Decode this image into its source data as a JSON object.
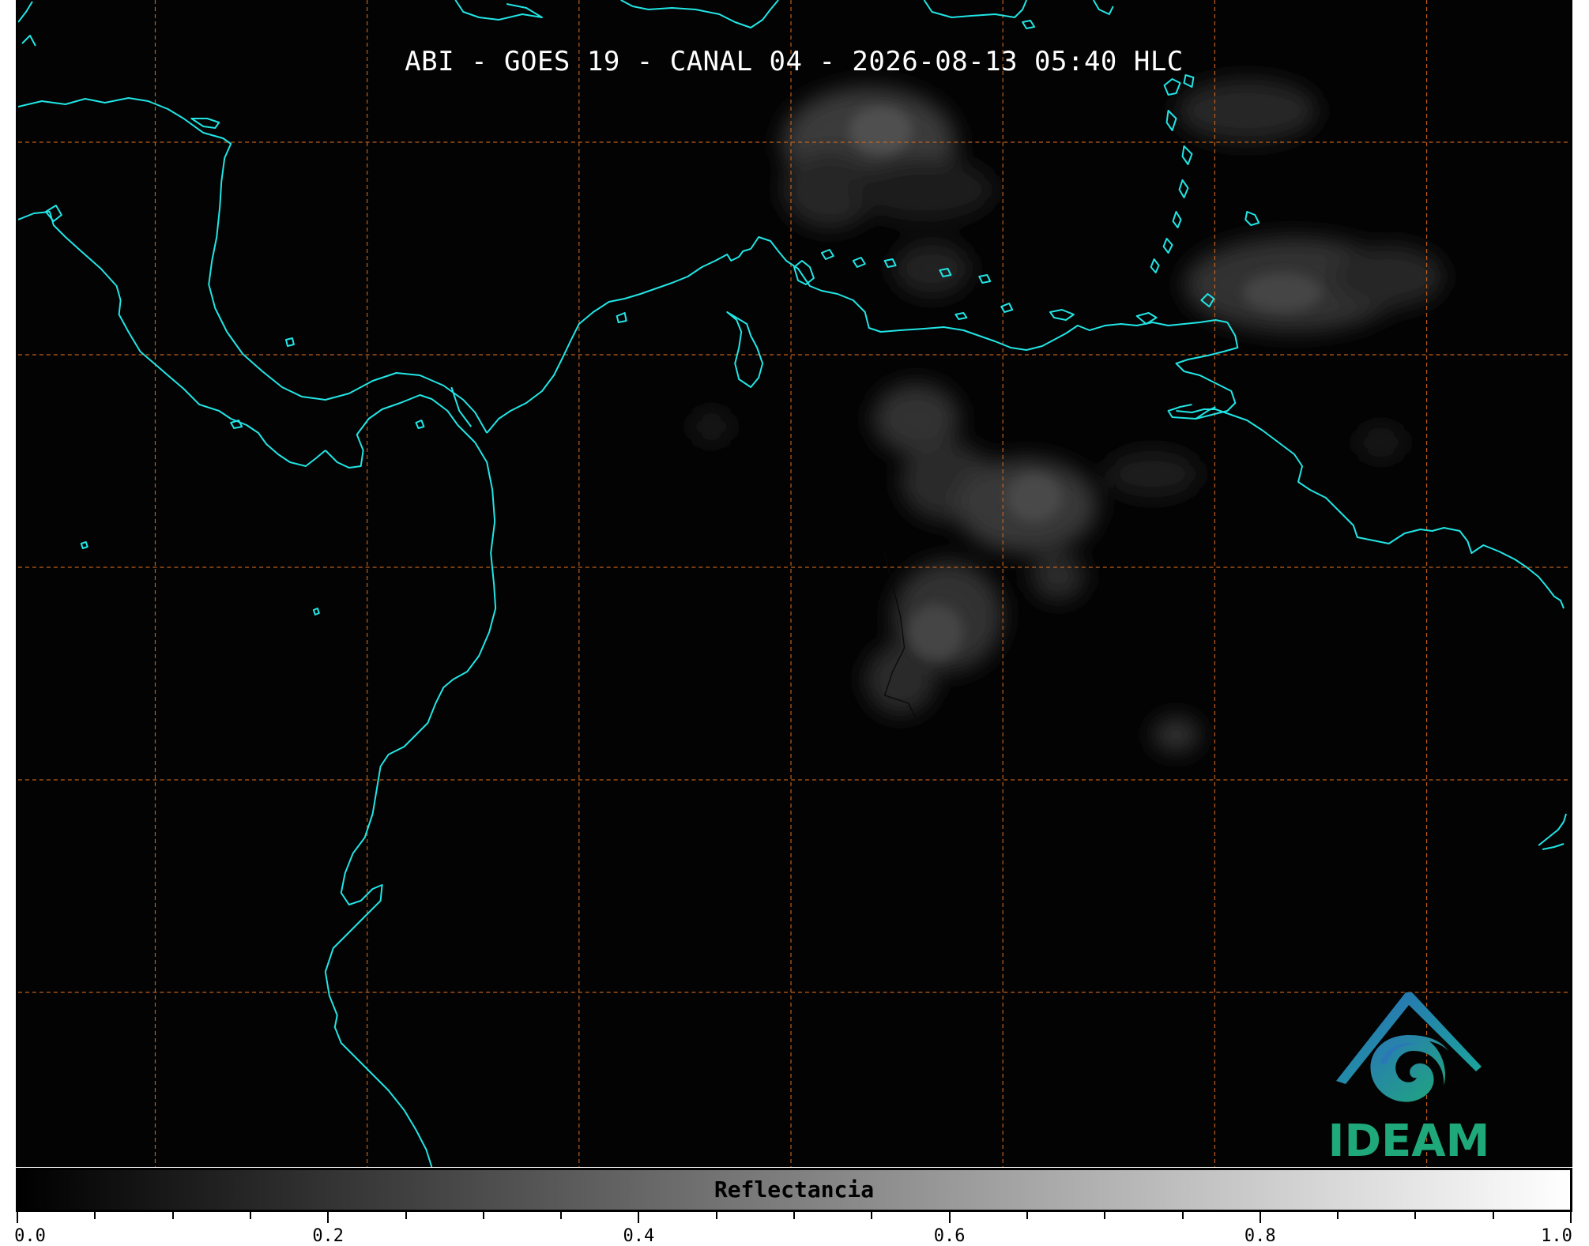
{
  "title": "ABI - GOES 19 - CANAL 04 - 2026-08-13 05:40 HLC",
  "colors": {
    "coastline": "#22e5e5",
    "grid": "#d2691e",
    "background": "#030303",
    "logo_text": "#1fa87a",
    "logo_blue": "#2b6cb8",
    "logo_teal": "#1aa89a"
  },
  "logo": {
    "text": "IDEAM"
  },
  "colorbar": {
    "label": "Reflectancia",
    "min": 0.0,
    "max": 1.0,
    "colormap": "gray",
    "ticks": [
      {
        "value": 0.0,
        "label": "0.0"
      },
      {
        "value": 0.2,
        "label": "0.2"
      },
      {
        "value": 0.4,
        "label": "0.4"
      },
      {
        "value": 0.6,
        "label": "0.6"
      },
      {
        "value": 0.8,
        "label": "0.8"
      },
      {
        "value": 1.0,
        "label": "1.0"
      }
    ],
    "minor_step": 0.05
  }
}
